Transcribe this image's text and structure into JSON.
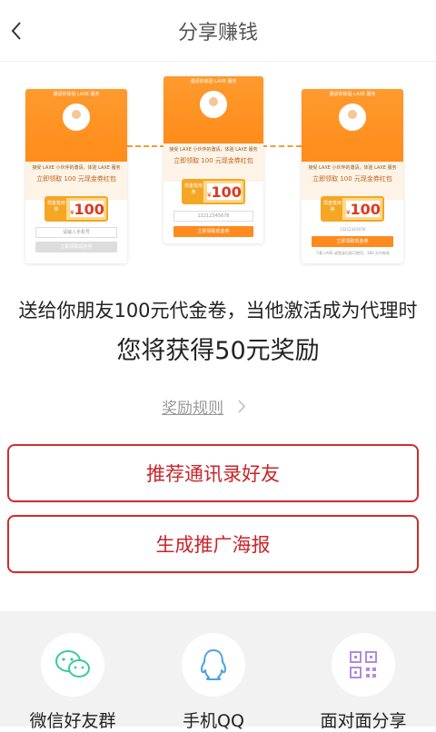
{
  "header": {
    "title": "分享赚钱"
  },
  "illustration": {
    "phone_title": "邀请你体验 LAXE 服务",
    "intro_line": "接受 LAXE 小伙伴的邀请，体验 LAXE 服务",
    "gift_line": "立即领取 100 元现金券红包",
    "ticket_label": "现金抵用券",
    "ticket_currency": "¥",
    "ticket_value": "100",
    "input_placeholder": "请输入手机号",
    "phone_number": "13212345678",
    "claim_button": "立即领取现金券",
    "notice_line": "下载 LAXE 或登录后即可使用，180 天内有效"
  },
  "promo": {
    "line1": "送给你朋友100元代金卷，当他激活成为代理时",
    "line2": "您将获得50元奖励"
  },
  "rules_link": "奖励规则",
  "buttons": {
    "recommend_contacts": "推荐通讯录好友",
    "generate_poster": "生成推广海报"
  },
  "share": {
    "wechat": "微信好友群",
    "qq": "手机QQ",
    "face": "面对面分享"
  },
  "colors": {
    "accent_red": "#c9252a",
    "orange": "#ff8c1a",
    "wechat_green": "#3cc99a",
    "qq_blue": "#4aa3e0",
    "qr_purple": "#b58ad8"
  }
}
